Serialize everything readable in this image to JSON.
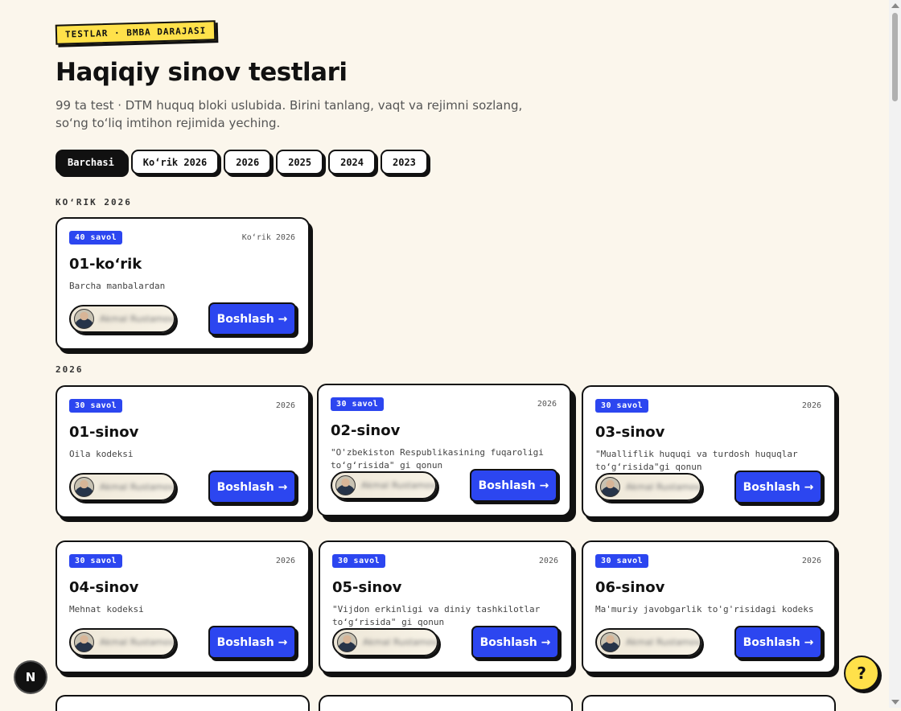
{
  "header": {
    "eyebrow": "TESTLAR · BMBA DARAJASI",
    "title": "Haqiqiy sinov testlari",
    "subtitle": "99 ta test · DTM huquq bloki uslubida. Birini tanlang, vaqt va rejimni sozlang, so‘ng to‘liq imtihon rejimida yeching."
  },
  "filters": [
    "Barchasi",
    "Koʻrik 2026",
    "2026",
    "2025",
    "2024",
    "2023"
  ],
  "active_filter": "Barchasi",
  "sections": [
    {
      "label": "KOʻRIK 2026"
    },
    {
      "label": "2026"
    }
  ],
  "cards": [
    {
      "badge": "40 savol",
      "year": "Koʻrik 2026",
      "title": "01-koʻrik",
      "desc": "Barcha manbalardan",
      "author": "Akmal Rustamov",
      "button": "Boshlash →"
    },
    {
      "badge": "30 savol",
      "year": "2026",
      "title": "01-sinov",
      "desc": "Oila kodeksi",
      "author": "Akmal Rustamov",
      "button": "Boshlash →"
    },
    {
      "badge": "30 savol",
      "year": "2026",
      "title": "02-sinov",
      "desc": "\"O'zbekiston Respublikasining fuqaroligi toʻgʻrisida\" gi qonun",
      "author": "Akmal Rustamov",
      "button": "Boshlash →"
    },
    {
      "badge": "30 savol",
      "year": "2026",
      "title": "03-sinov",
      "desc": "\"Mualliflik huquqi va turdosh huquqlar toʻgʻrisida\"gi qonun",
      "author": "Akmal Rustamov",
      "button": "Boshlash →"
    },
    {
      "badge": "30 savol",
      "year": "2026",
      "title": "04-sinov",
      "desc": "Mehnat kodeksi",
      "author": "Akmal Rustamov",
      "button": "Boshlash →"
    },
    {
      "badge": "30 savol",
      "year": "2026",
      "title": "05-sinov",
      "desc": "\"Vijdon erkinligi va diniy tashkilotlar toʻgʻrisida\" gi qonun",
      "author": "Akmal Rustamov",
      "button": "Boshlash →"
    },
    {
      "badge": "30 savol",
      "year": "2026",
      "title": "06-sinov",
      "desc": "Ma'muriy javobgarlik to'g'risidagi kodeks",
      "author": "Akmal Rustamov",
      "button": "Boshlash →"
    }
  ],
  "fab": {
    "logo_letter": "N",
    "help_symbol": "?"
  }
}
